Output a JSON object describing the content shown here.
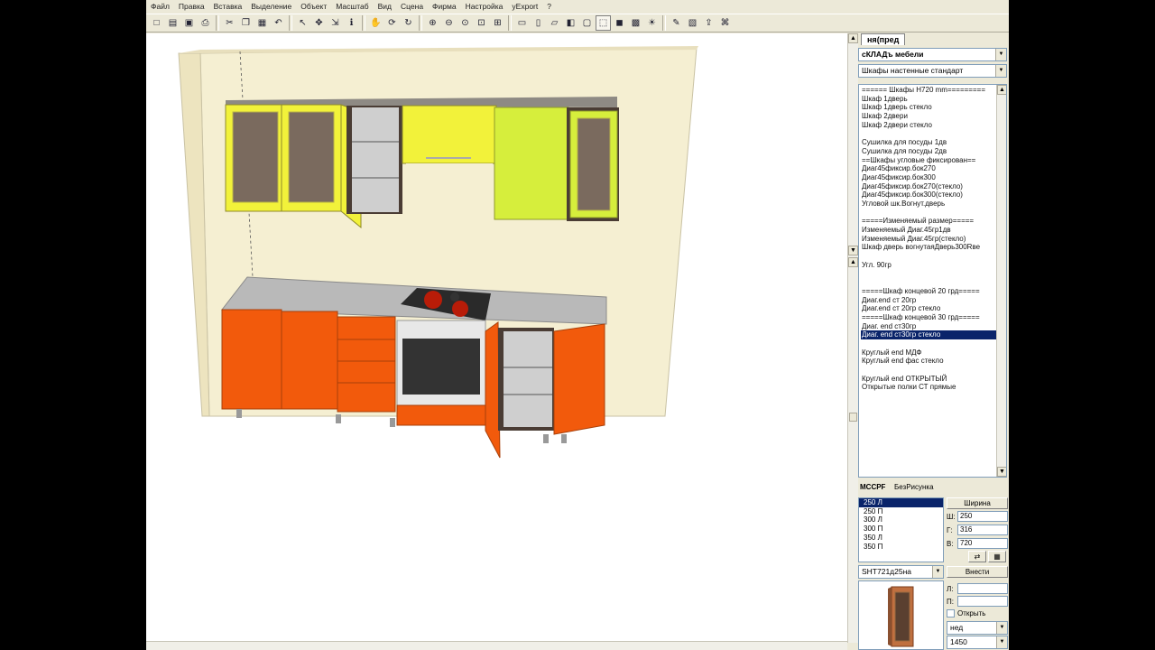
{
  "menu": [
    "Файл",
    "Правка",
    "Вставка",
    "Выделение",
    "Объект",
    "Масштаб",
    "Вид",
    "Сцена",
    "Фирма",
    "Настройка",
    "yExport",
    "?"
  ],
  "toolbar_icons": [
    "new-icon",
    "open-icon",
    "save-icon",
    "print-icon",
    "cut-icon",
    "copy-icon",
    "paste-icon",
    "undo-icon",
    "select-icon",
    "move-icon",
    "scale-icon",
    "info-icon",
    "pan-icon",
    "rotate-icon",
    "orbit-icon",
    "zoom-in-icon",
    "zoom-out-icon",
    "zoom-fit-icon",
    "zoom-window-icon",
    "zoom-all-icon",
    "view-front-icon",
    "view-top-icon",
    "view-side-icon",
    "view-iso-icon",
    "box-icon",
    "wireframe-icon",
    "shaded-icon",
    "texture-icon",
    "light-icon",
    "tools-icon",
    "render-icon",
    "export-icon",
    "camera-icon"
  ],
  "panel": {
    "tab_label": "ня(пред",
    "library_combo": "сКЛАДъ мебели",
    "category_combo": "Шкафы настенные стандарт",
    "items": [
      "====== Шкафы H720 mm=========",
      "Шкаф  1дверь",
      "Шкаф  1дверь стекло",
      "Шкаф  2двери",
      "Шкаф  2двери стекло",
      "",
      "Сушилка для посуды 1дв",
      "Сушилка для посуды 2дв",
      "==Шкафы угловые фиксирован==",
      "Диаг45фиксир.бок270",
      "Диаг45фиксир.бок300",
      "Диаг45фиксир.бок270(стекло)",
      "Диаг45фиксир.бок300(стекло)",
      "Угловой шк.Вогнут.дверь",
      "",
      "=====Изменяемый размер=====",
      "Изменяемый Диаг.45гр1дв",
      "Изменяемый Диаг.45гр(стекло)",
      "Шкаф дверь вогнутаяДверь300Rве",
      "",
      "Угл. 90гр",
      "",
      "",
      "=====Шкаф концевой 20 грд=====",
      "Диаг.end ст 20гр",
      "Диаг.end ст 20гр  стекло",
      "=====Шкаф концевой 30 грд=====",
      "Диаг. end ст30гр",
      "Диаг. end ст30гр  стекло",
      "",
      "Круглый end МДФ",
      "Круглый end фас стекло",
      "",
      "Круглый end ОТКРЫТЫЙ",
      "Открытые полки СТ прямые"
    ],
    "selected_item_index": 28,
    "material_label": "МССРF",
    "material_value": "БезРисунка",
    "sizes": [
      "250 Л",
      "250  П",
      "300 Л",
      "300  П",
      "350 Л",
      "350  П"
    ],
    "selected_size_index": 0,
    "width_button": "Ширина",
    "w_label": "Ш:",
    "w_value": "250",
    "d_label": "Г:",
    "d_value": "316",
    "h_label": "В:",
    "h_value": "720",
    "article_combo": "SHT721д25на",
    "insert_button": "Внести",
    "l_label": "Л:",
    "p_label": "П:",
    "open_label": "Открыть",
    "combo_bottom1": "нед",
    "combo_bottom2": "1450"
  },
  "colors": {
    "upper_yellow": "#f2f23a",
    "upper_lime": "#d6ee3c",
    "lower_orange": "#f25a0c",
    "wall": "#f5efd2",
    "countertop": "#b9b9b9",
    "carcass_dark": "#4a3c34",
    "selection": "#0a246a"
  }
}
